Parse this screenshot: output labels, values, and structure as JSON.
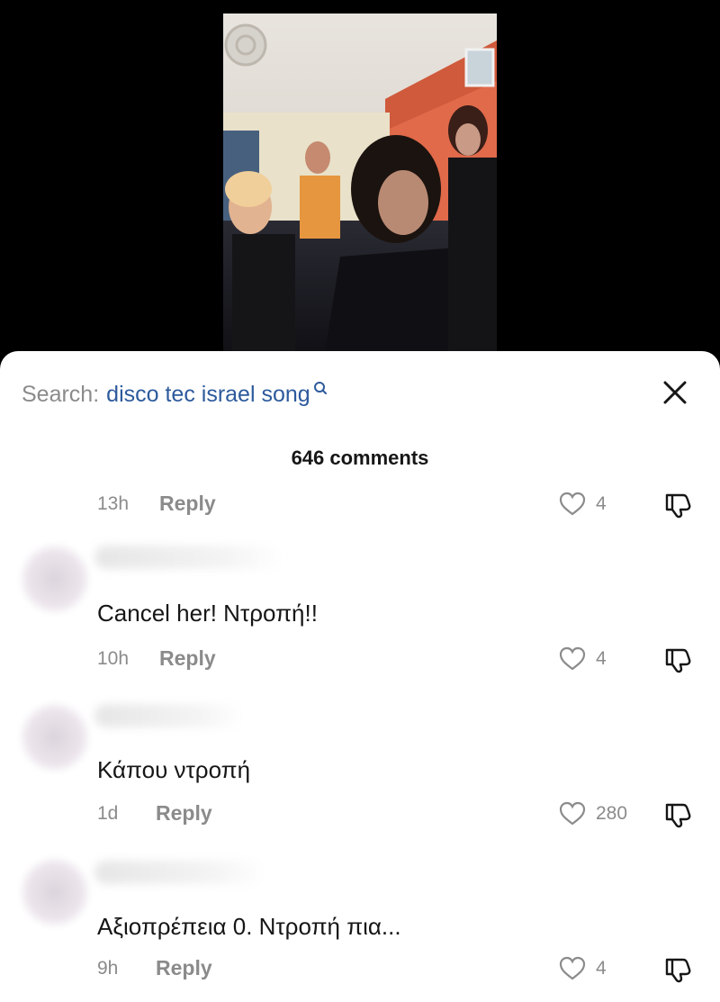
{
  "search": {
    "prefix": "Search:",
    "query": "disco tec israel song"
  },
  "comments_header": {
    "count_label": "646 comments"
  },
  "reply_label": "Reply",
  "comments": [
    {
      "text": "",
      "time": "13h",
      "likes": "4"
    },
    {
      "text": "Cancel her! Ντροπή!!",
      "time": "10h",
      "likes": "4"
    },
    {
      "text": "Κάπου ντροπή",
      "time": "1d",
      "likes": "280"
    },
    {
      "text": "Αξιοπρέπεια 0. Ντροπή πια...",
      "time": "9h",
      "likes": "4"
    }
  ],
  "colors": {
    "accent_link": "#2d5a9c",
    "muted_text": "#8b8b8b",
    "primary_text": "#161616"
  },
  "icons": [
    "search-icon",
    "close-icon",
    "heart-icon",
    "thumbs-down-icon"
  ]
}
